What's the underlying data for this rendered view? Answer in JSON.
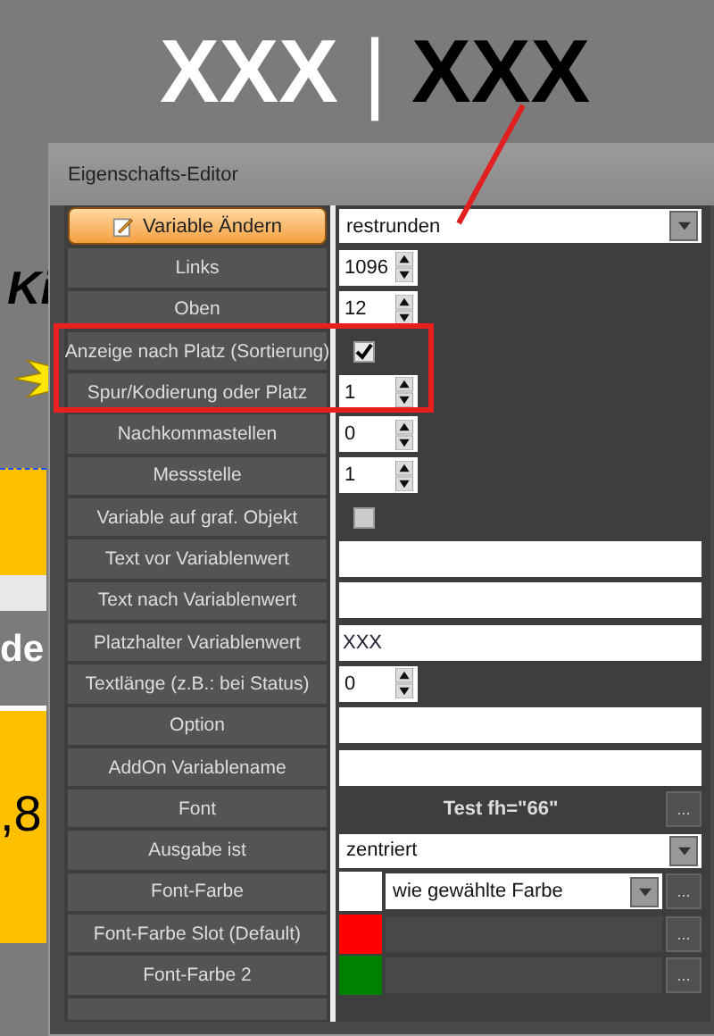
{
  "header": {
    "left": "XXX",
    "separator": "|",
    "right": "XXX"
  },
  "side_texts": [
    "Ki",
    "de",
    ",8"
  ],
  "dialog": {
    "title": "Eigenschafts-Editor",
    "rows": [
      {
        "label": "Variable Ändern",
        "label_button": true,
        "kind": "select",
        "value": "restrunden"
      },
      {
        "label": "Links",
        "label_button": false,
        "kind": "spin",
        "value": "1096"
      },
      {
        "label": "Oben",
        "label_button": false,
        "kind": "spin",
        "value": "12"
      },
      {
        "label": "Anzeige nach Platz (Sortierung)",
        "label_button": false,
        "kind": "check",
        "checked": true
      },
      {
        "label": "Spur/Kodierung oder Platz",
        "label_button": false,
        "kind": "spin",
        "value": "1"
      },
      {
        "label": "Nachkommastellen",
        "label_button": false,
        "kind": "spin",
        "value": "0"
      },
      {
        "label": "Messstelle",
        "label_button": false,
        "kind": "spin",
        "value": "1"
      },
      {
        "label": "Variable auf graf. Objekt",
        "label_button": false,
        "kind": "check",
        "checked": false
      },
      {
        "label": "Text vor Variablenwert",
        "label_button": false,
        "kind": "text"
      },
      {
        "label": "Text nach Variablenwert",
        "label_button": false,
        "kind": "text"
      },
      {
        "label": "Platzhalter Variablenwert",
        "label_button": false,
        "kind": "text",
        "value": "XXX"
      },
      {
        "label": "Textlänge (z.B.: bei Status)",
        "label_button": false,
        "kind": "spin",
        "value": "0"
      },
      {
        "label": "Option",
        "label_button": false,
        "kind": "text"
      },
      {
        "label": "AddOn Variablename",
        "label_button": false,
        "kind": "text"
      },
      {
        "label": "Font",
        "label_button": false,
        "kind": "font",
        "value": "Test fh=\"66\"",
        "button": "..."
      },
      {
        "label": "Ausgabe ist",
        "label_button": false,
        "kind": "select",
        "value": "zentriert"
      },
      {
        "label": "Font-Farbe",
        "label_button": false,
        "kind": "color",
        "color": "#ffffff",
        "value": "wie gewählte Farbe",
        "button": "..."
      },
      {
        "label": "Font-Farbe Slot (Default)",
        "label_button": false,
        "kind": "color",
        "color": "#ff0000",
        "button": "..."
      },
      {
        "label": "Font-Farbe 2",
        "label_button": false,
        "kind": "color",
        "color": "#008000",
        "button": "..."
      }
    ]
  }
}
